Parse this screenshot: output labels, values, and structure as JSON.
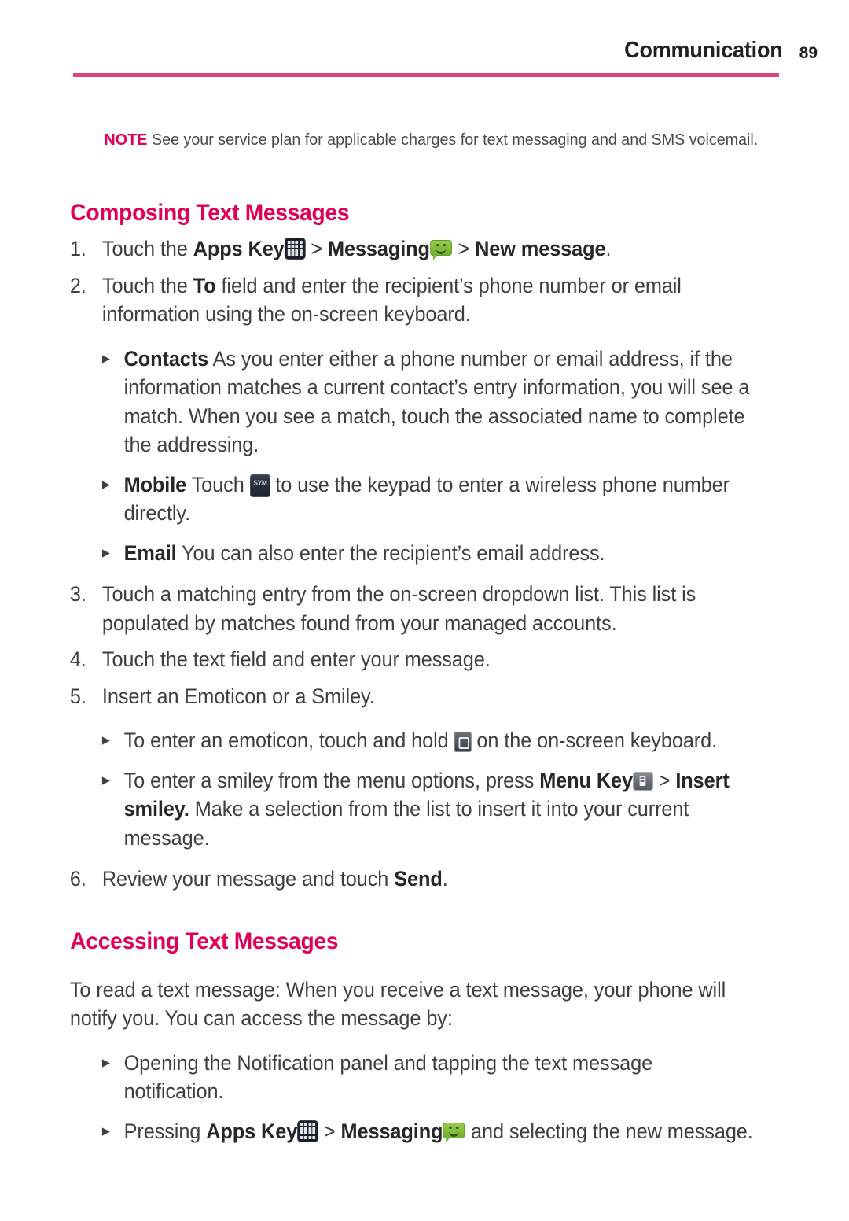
{
  "header": {
    "title": "Communication",
    "page_number": "89",
    "rule_color": "#e0457b"
  },
  "colors": {
    "accent_magenta": "#e0005a",
    "body_text": "#3f3f3f",
    "icon_green": "#83bc3c",
    "icon_dark": "#1b1e27"
  },
  "note": {
    "tag": "NOTE",
    "text": " See your service plan for applicable charges for text messaging and and SMS voicemail."
  },
  "sections": {
    "composing": {
      "heading": "Composing Text Messages",
      "step1": {
        "num": "1.",
        "t1": "Touch the ",
        "b1": "Apps Key",
        "icon1": "apps-key-icon",
        "t2": " > ",
        "b2": "Messaging",
        "icon2": "messaging-icon",
        "t3": " > ",
        "b3": "New message",
        "t4": "."
      },
      "step2": {
        "num": "2.",
        "t1": "Touch the ",
        "b1": "To",
        "t2": " field and enter the recipient’s phone number or email information using the on-screen keyboard."
      },
      "bullet_contacts": {
        "marker": "▸",
        "label": "Contacts",
        "text": " As you enter either a phone number or email address, if the information matches a current contact’s entry information, you will see a match. When you see a match, touch the associated name to complete the addressing."
      },
      "bullet_mobile": {
        "marker": "▸",
        "label": "Mobile",
        "t1": " Touch ",
        "icon": "sym-key-icon",
        "t2": " to use the keypad to enter a wireless phone number directly."
      },
      "bullet_email": {
        "marker": "▸",
        "label": "Email",
        "text": " You can also enter the recipient’s email address."
      },
      "step3": {
        "num": "3.",
        "text": "Touch a matching entry from the on-screen dropdown list. This list is populated by matches found from your managed accounts."
      },
      "step4": {
        "num": "4.",
        "text": "Touch the text field and enter your message."
      },
      "step5": {
        "num": "5.",
        "text": "Insert an Emoticon or a Smiley."
      },
      "bullet_emoticon": {
        "marker": "▸",
        "t1": "To enter an emoticon, touch and hold ",
        "icon": "emoticon-key-icon",
        "t2": " on the on-screen keyboard."
      },
      "bullet_smiley": {
        "marker": "▸",
        "t1": "To enter a smiley from the menu options, press ",
        "b1": "Menu Key",
        "icon": "menu-key-icon",
        "t2": " > ",
        "b2": "Insert smiley.",
        "t3": " Make a selection from the list to insert it into your current message."
      },
      "step6": {
        "num": "6.",
        "t1": "Review your message and touch ",
        "b1": "Send",
        "t2": "."
      }
    },
    "accessing": {
      "heading": "Accessing Text Messages",
      "intro": "To read a text message: When you receive a text message, your phone will notify you. You can access the message by:",
      "bullet_notification": {
        "marker": "▸",
        "text": "Opening the Notification panel and tapping the text message notification."
      },
      "bullet_pressing": {
        "marker": "▸",
        "t1": "Pressing ",
        "b1": "Apps Key",
        "icon1": "apps-key-icon",
        "t2": " > ",
        "b2": "Messaging",
        "icon2": "messaging-icon",
        "t3": " and selecting the new message."
      }
    }
  }
}
